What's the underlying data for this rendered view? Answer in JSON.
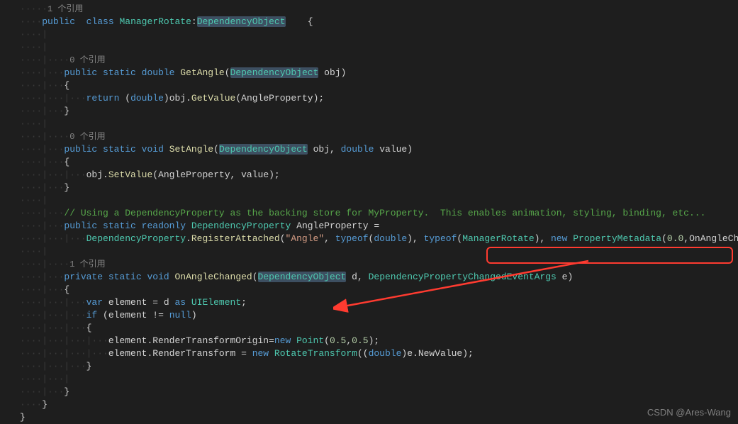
{
  "codelens": {
    "ref1_top": "1 个引用",
    "ref0_a": "0 个引用",
    "ref0_b": "0 个引用",
    "ref1_b": "1 个引用"
  },
  "tokens": {
    "public": "public",
    "private": "private",
    "class": "class",
    "static": "static",
    "readonly": "readonly",
    "double": "double",
    "void": "void",
    "return": "return",
    "var": "var",
    "if": "if",
    "as": "as",
    "new": "new",
    "null": "null",
    "typeof": "typeof"
  },
  "types": {
    "ManagerRotate": "ManagerRotate",
    "DependencyObject": "DependencyObject",
    "DependencyProperty": "DependencyProperty",
    "DependencyPropertyChangedEventArgs": "DependencyPropertyChangedEventArgs",
    "UIElement": "UIElement",
    "Point": "Point",
    "RotateTransform": "RotateTransform",
    "PropertyMetadata": "PropertyMetadata"
  },
  "identifiers": {
    "GetAngle": "GetAngle",
    "SetAngle": "SetAngle",
    "OnAngleChanged": "OnAngleChanged",
    "obj": "obj",
    "value": "value",
    "d": "d",
    "e": "e",
    "element": "element",
    "GetValue": "GetValue",
    "SetValue": "SetValue",
    "AngleProperty": "AngleProperty",
    "RegisterAttached": "RegisterAttached",
    "RenderTransform": "RenderTransform",
    "RenderTransformOrigin": "RenderTransformOrigin",
    "NewValue": "NewValue"
  },
  "strings": {
    "angle": "\"Angle\""
  },
  "numbers": {
    "zero_five_a": "0.5",
    "zero_five_b": "0.5",
    "zero_zero": "0.0"
  },
  "comments": {
    "backing": "// Using a DependencyProperty as the backing store for MyProperty.  This enables animation, styling, binding, etc..."
  },
  "watermark": "CSDN @Ares-Wang"
}
